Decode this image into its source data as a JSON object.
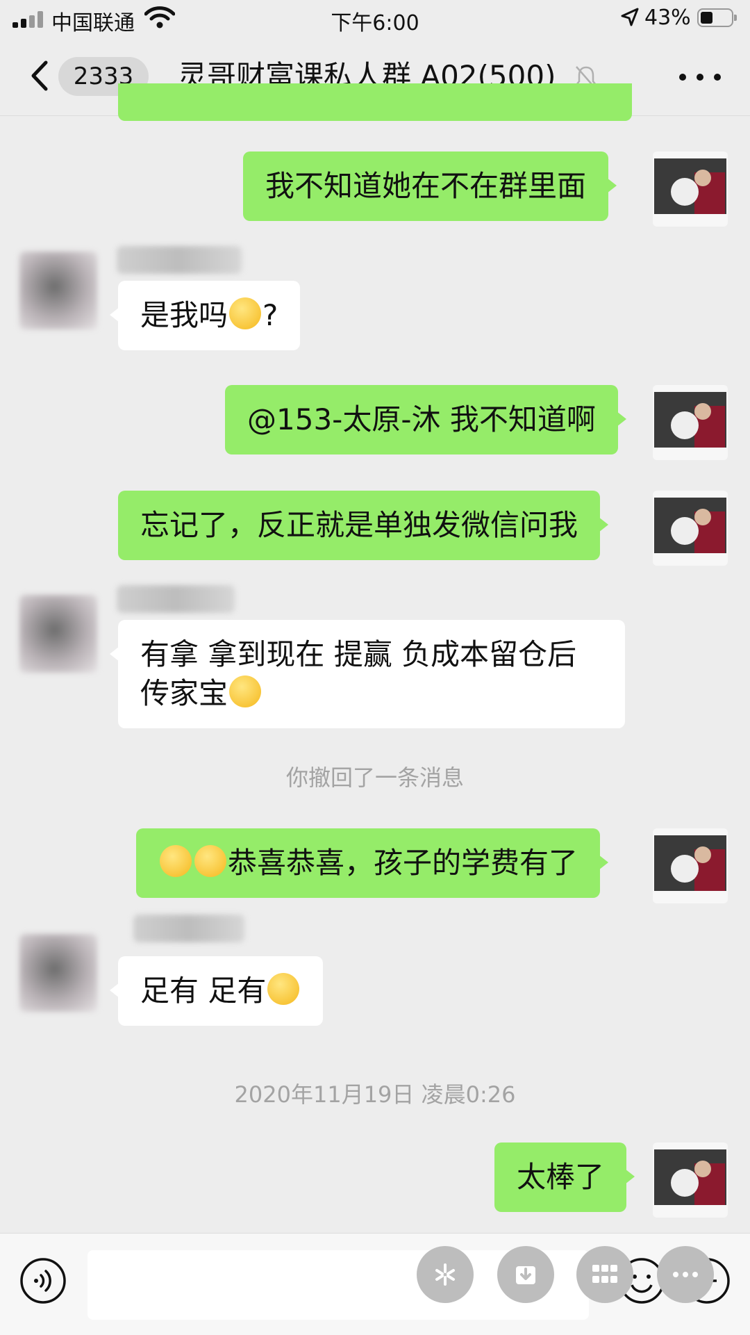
{
  "status_bar": {
    "carrier": "中国联通",
    "time": "下午6:00",
    "battery_percent": "43%",
    "battery_level": 0.43
  },
  "nav": {
    "unread_count": "2333",
    "chat_title": "灵哥财富课私人群 A02(500)"
  },
  "messages": [
    {
      "side": "right",
      "text": "我不知道她在不在群里面"
    },
    {
      "side": "left",
      "sender_hint": "153",
      "text": "是我吗",
      "suffix": "?"
    },
    {
      "side": "right",
      "text": "@153-太原-沐 我不知道啊"
    },
    {
      "side": "right",
      "text": "忘记了，反正就是单独发微信问我"
    },
    {
      "side": "left",
      "text_line1": "有拿 拿到现在 提赢 负成本留仓后",
      "text_line2": "传家宝"
    },
    {
      "side": "right",
      "text": "恭喜恭喜，孩子的学费有了"
    },
    {
      "side": "left",
      "text": "足有 足有"
    },
    {
      "side": "right",
      "text": "太棒了"
    }
  ],
  "system_notices": {
    "recall": "你撤回了一条消息",
    "timestamp": "2020年11月19日 凌晨0:26"
  },
  "icons": {
    "back": "chevron-left-icon",
    "mute": "bell-slash-icon",
    "more": "more-dots-icon",
    "voice": "voice-icon",
    "emoji": "emoji-icon",
    "plus": "plus-icon"
  },
  "colors": {
    "sent_bubble": "#95ec69",
    "received_bubble": "#ffffff",
    "background": "#ededed"
  }
}
